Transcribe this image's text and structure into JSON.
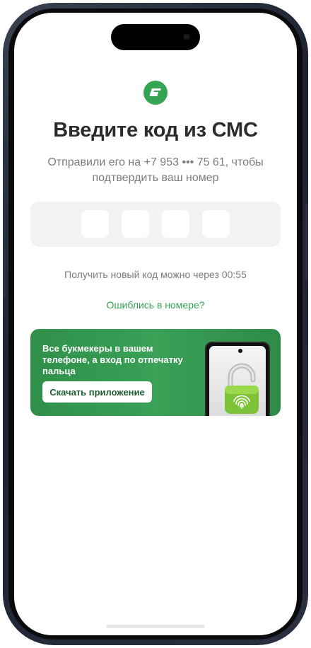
{
  "screen": {
    "title": "Введите код из СМС",
    "subtitle": "Отправили его на +7 953 ••• 75 61, чтобы подтвердить ваш номер",
    "resend_text": "Получить новый код можно через 00:55",
    "wrong_number_link": "Ошиблись в номере?"
  },
  "code_input": {
    "digits": [
      "",
      "",
      "",
      ""
    ]
  },
  "banner": {
    "text": "Все букмекеры в вашем телефоне, а вход по отпечатку пальца",
    "button_label": "Скачать приложение"
  },
  "icons": {
    "logo": "app-logo-icon",
    "lock": "fingerprint-lock-icon"
  },
  "colors": {
    "brand_green": "#34a352",
    "banner_green": "#3aa157",
    "title": "#2b2b2e",
    "muted": "#7b7b80"
  }
}
